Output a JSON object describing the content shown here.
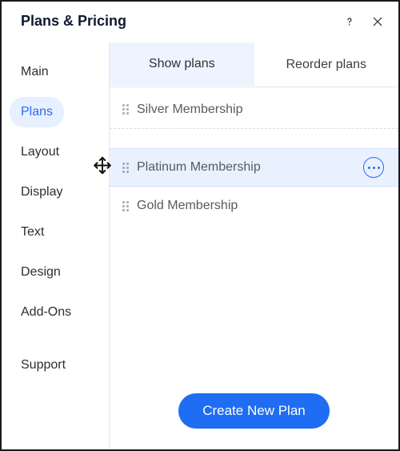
{
  "header": {
    "title": "Plans & Pricing"
  },
  "sidebar": {
    "items": [
      {
        "label": "Main",
        "active": false
      },
      {
        "label": "Plans",
        "active": true
      },
      {
        "label": "Layout",
        "active": false
      },
      {
        "label": "Display",
        "active": false
      },
      {
        "label": "Text",
        "active": false
      },
      {
        "label": "Design",
        "active": false
      },
      {
        "label": "Add-Ons",
        "active": false
      }
    ],
    "support": {
      "label": "Support"
    }
  },
  "tabs": {
    "show": {
      "label": "Show plans",
      "active": true
    },
    "reorder": {
      "label": "Reorder plans",
      "active": false
    }
  },
  "plans": [
    {
      "label": "Silver Membership",
      "highlight": false
    },
    {
      "label": "Platinum Membership",
      "highlight": true
    },
    {
      "label": "Gold Membership",
      "highlight": false
    }
  ],
  "footer": {
    "create_label": "Create New Plan"
  },
  "colors": {
    "accent": "#1f6df2",
    "selection": "#e9f1ff",
    "sidebarActive": "#e6f0ff"
  }
}
